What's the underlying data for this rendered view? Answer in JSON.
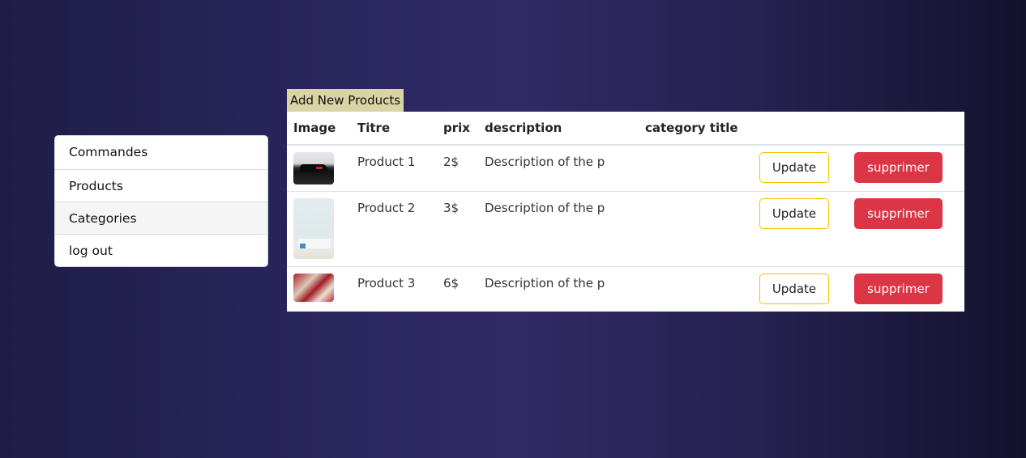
{
  "sidebar": {
    "items": [
      {
        "label": "Commandes"
      },
      {
        "label": "Products"
      },
      {
        "label": "Categories"
      },
      {
        "label": "log out"
      }
    ]
  },
  "add_link": "Add New Products",
  "table": {
    "headers": [
      "Image",
      "Titre",
      "prix",
      "description",
      "category title",
      "",
      ""
    ],
    "rows": [
      {
        "title": "Product 1",
        "price": "2$",
        "description": "Description of the p",
        "category": "",
        "update": "Update",
        "delete": "supprimer"
      },
      {
        "title": "Product 2",
        "price": "3$",
        "description": "Description of the p",
        "category": "",
        "update": "Update",
        "delete": "supprimer"
      },
      {
        "title": "Product 3",
        "price": "6$",
        "description": "Description of the p",
        "category": "",
        "update": "Update",
        "delete": "supprimer"
      }
    ]
  },
  "colors": {
    "update_border": "#f2c200",
    "delete_bg": "#dc3545",
    "add_link_bg": "#d8d4a6"
  }
}
